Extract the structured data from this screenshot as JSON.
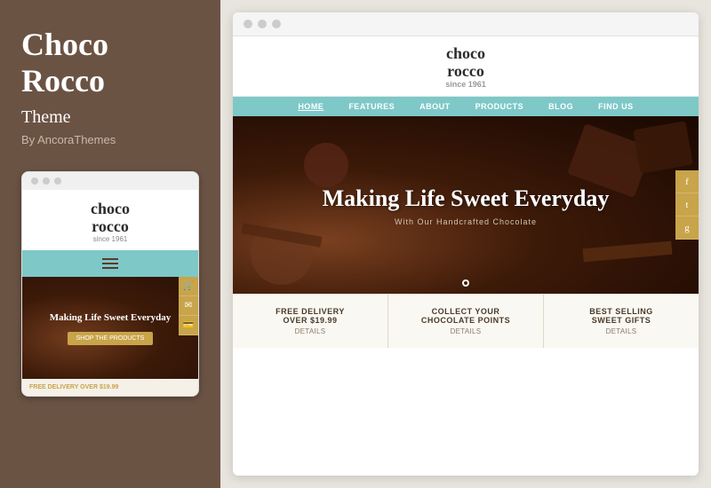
{
  "sidebar": {
    "title_line1": "Choco",
    "title_line2": "Rocco",
    "subtitle": "Theme",
    "by": "By AncoraThemes"
  },
  "mobile": {
    "logo_line1": "choco",
    "logo_line2": "rocco",
    "since": "since 1961",
    "hero_text": "Making Life Sweet Everyday",
    "hero_btn": "SHOP THE PRODUCTS",
    "footer_text": "FREE DELIVERY OVER",
    "footer_price": "$19.99"
  },
  "browser": {
    "site_logo_line1": "choco",
    "site_logo_line2": "rocco",
    "site_since": "since 1961",
    "nav_items": [
      "HOME",
      "FEATURES",
      "ABOUT",
      "PRODUCTS",
      "BLOG",
      "FIND US"
    ],
    "hero_main": "Making Life Sweet Everyday",
    "hero_sub": "With Our Handcrafted Chocolate",
    "features": [
      {
        "title": "FREE DELIVERY\nOVER $19.99",
        "detail": "Details"
      },
      {
        "title": "COLLECT YOUR\nCHOCOLATE POINTS",
        "detail": "Details"
      },
      {
        "title": "BEST SELLING\nSWEET GIFTS",
        "detail": "Details"
      }
    ]
  },
  "dots": {
    "dot1": "●",
    "dot2": "●",
    "dot3": "●"
  },
  "icons": {
    "cart": "🛒",
    "email": "✉",
    "card": "💳",
    "share1": "f",
    "share2": "t",
    "share3": "g"
  }
}
